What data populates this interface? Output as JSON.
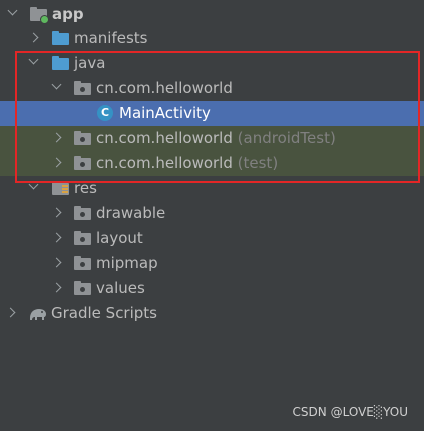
{
  "tree": {
    "app": "app",
    "manifests": "manifests",
    "java": "java",
    "package_main": "cn.com.helloworld",
    "main_activity": "MainActivity",
    "package_android_test": "cn.com.helloworld",
    "android_test_suffix": "(androidTest)",
    "package_test": "cn.com.helloworld",
    "test_suffix": "(test)",
    "res": "res",
    "drawable": "drawable",
    "layout": "layout",
    "mipmap": "mipmap",
    "values": "values",
    "gradle_scripts": "Gradle Scripts"
  },
  "class_icon_letter": "C",
  "watermark": "CSDN @LOVE░YOU",
  "colors": {
    "background": "#3c3f41",
    "selection": "#4b6eaf",
    "test_row": "#49533f",
    "highlight_box": "#e32626",
    "source_folder": "#4e9cd1"
  }
}
